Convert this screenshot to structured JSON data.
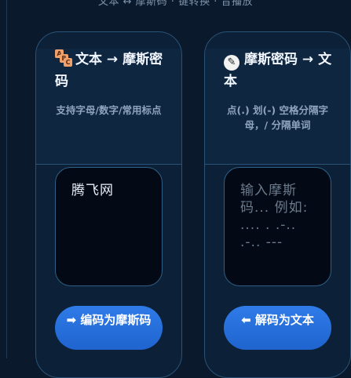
{
  "page": {
    "subtitle": "文本 ↔ 摩斯码 · 键转换 · 音播放"
  },
  "encode_card": {
    "icon": "abc-icon",
    "title": "文本 → 摩斯密码",
    "subtitle": "支持字母/数字/常用标点",
    "input_value": "腾飞网",
    "button_icon": "right-arrow-icon",
    "button_label": "➡ 编码为摩斯码"
  },
  "decode_card": {
    "icon": "pen-icon",
    "title": "摩斯密码 → 文本",
    "subtitle": "点(.) 划(-) 空格分隔字母，/ 分隔单词",
    "input_placeholder": "输入摩斯码... 例如: .... . .-.. .-.. ---",
    "button_icon": "left-arrow-icon",
    "button_label": "⬅ 解码为文本"
  },
  "colors": {
    "background": "#0a1a2c",
    "card": "#0c2137",
    "accent": "#2f7be8"
  }
}
